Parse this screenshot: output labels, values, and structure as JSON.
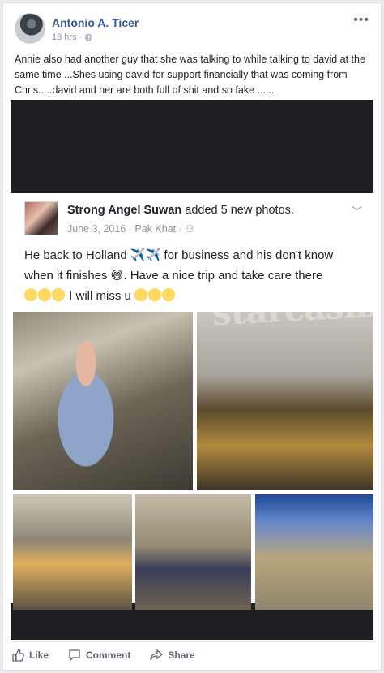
{
  "post": {
    "author": "Antonio A. Ticer",
    "time": "18 hrs",
    "audience_icon": "globe-icon",
    "more_label": "•••",
    "text": "Annie also had another guy that she was talking to while talking to david at the same time ...Shes using david for support financially that was coming from Chris.....david and her are both full of shit and so fake ......"
  },
  "shared": {
    "author": "Strong Angel Suwan",
    "action": "added 5 new photos.",
    "date": "June 3, 2016",
    "location": "Pak Khat",
    "text_line1": "He back to Holland ✈️✈️ for business and his don't know",
    "text_line2": "when it finishes 😅. Have a nice trip and take care there",
    "text_line3": "I will miss u",
    "watermark": "starcasm"
  },
  "actions": {
    "like": "Like",
    "comment": "Comment",
    "share": "Share"
  },
  "colors": {
    "link": "#365899",
    "meta": "#90949c",
    "action": "#606770"
  }
}
